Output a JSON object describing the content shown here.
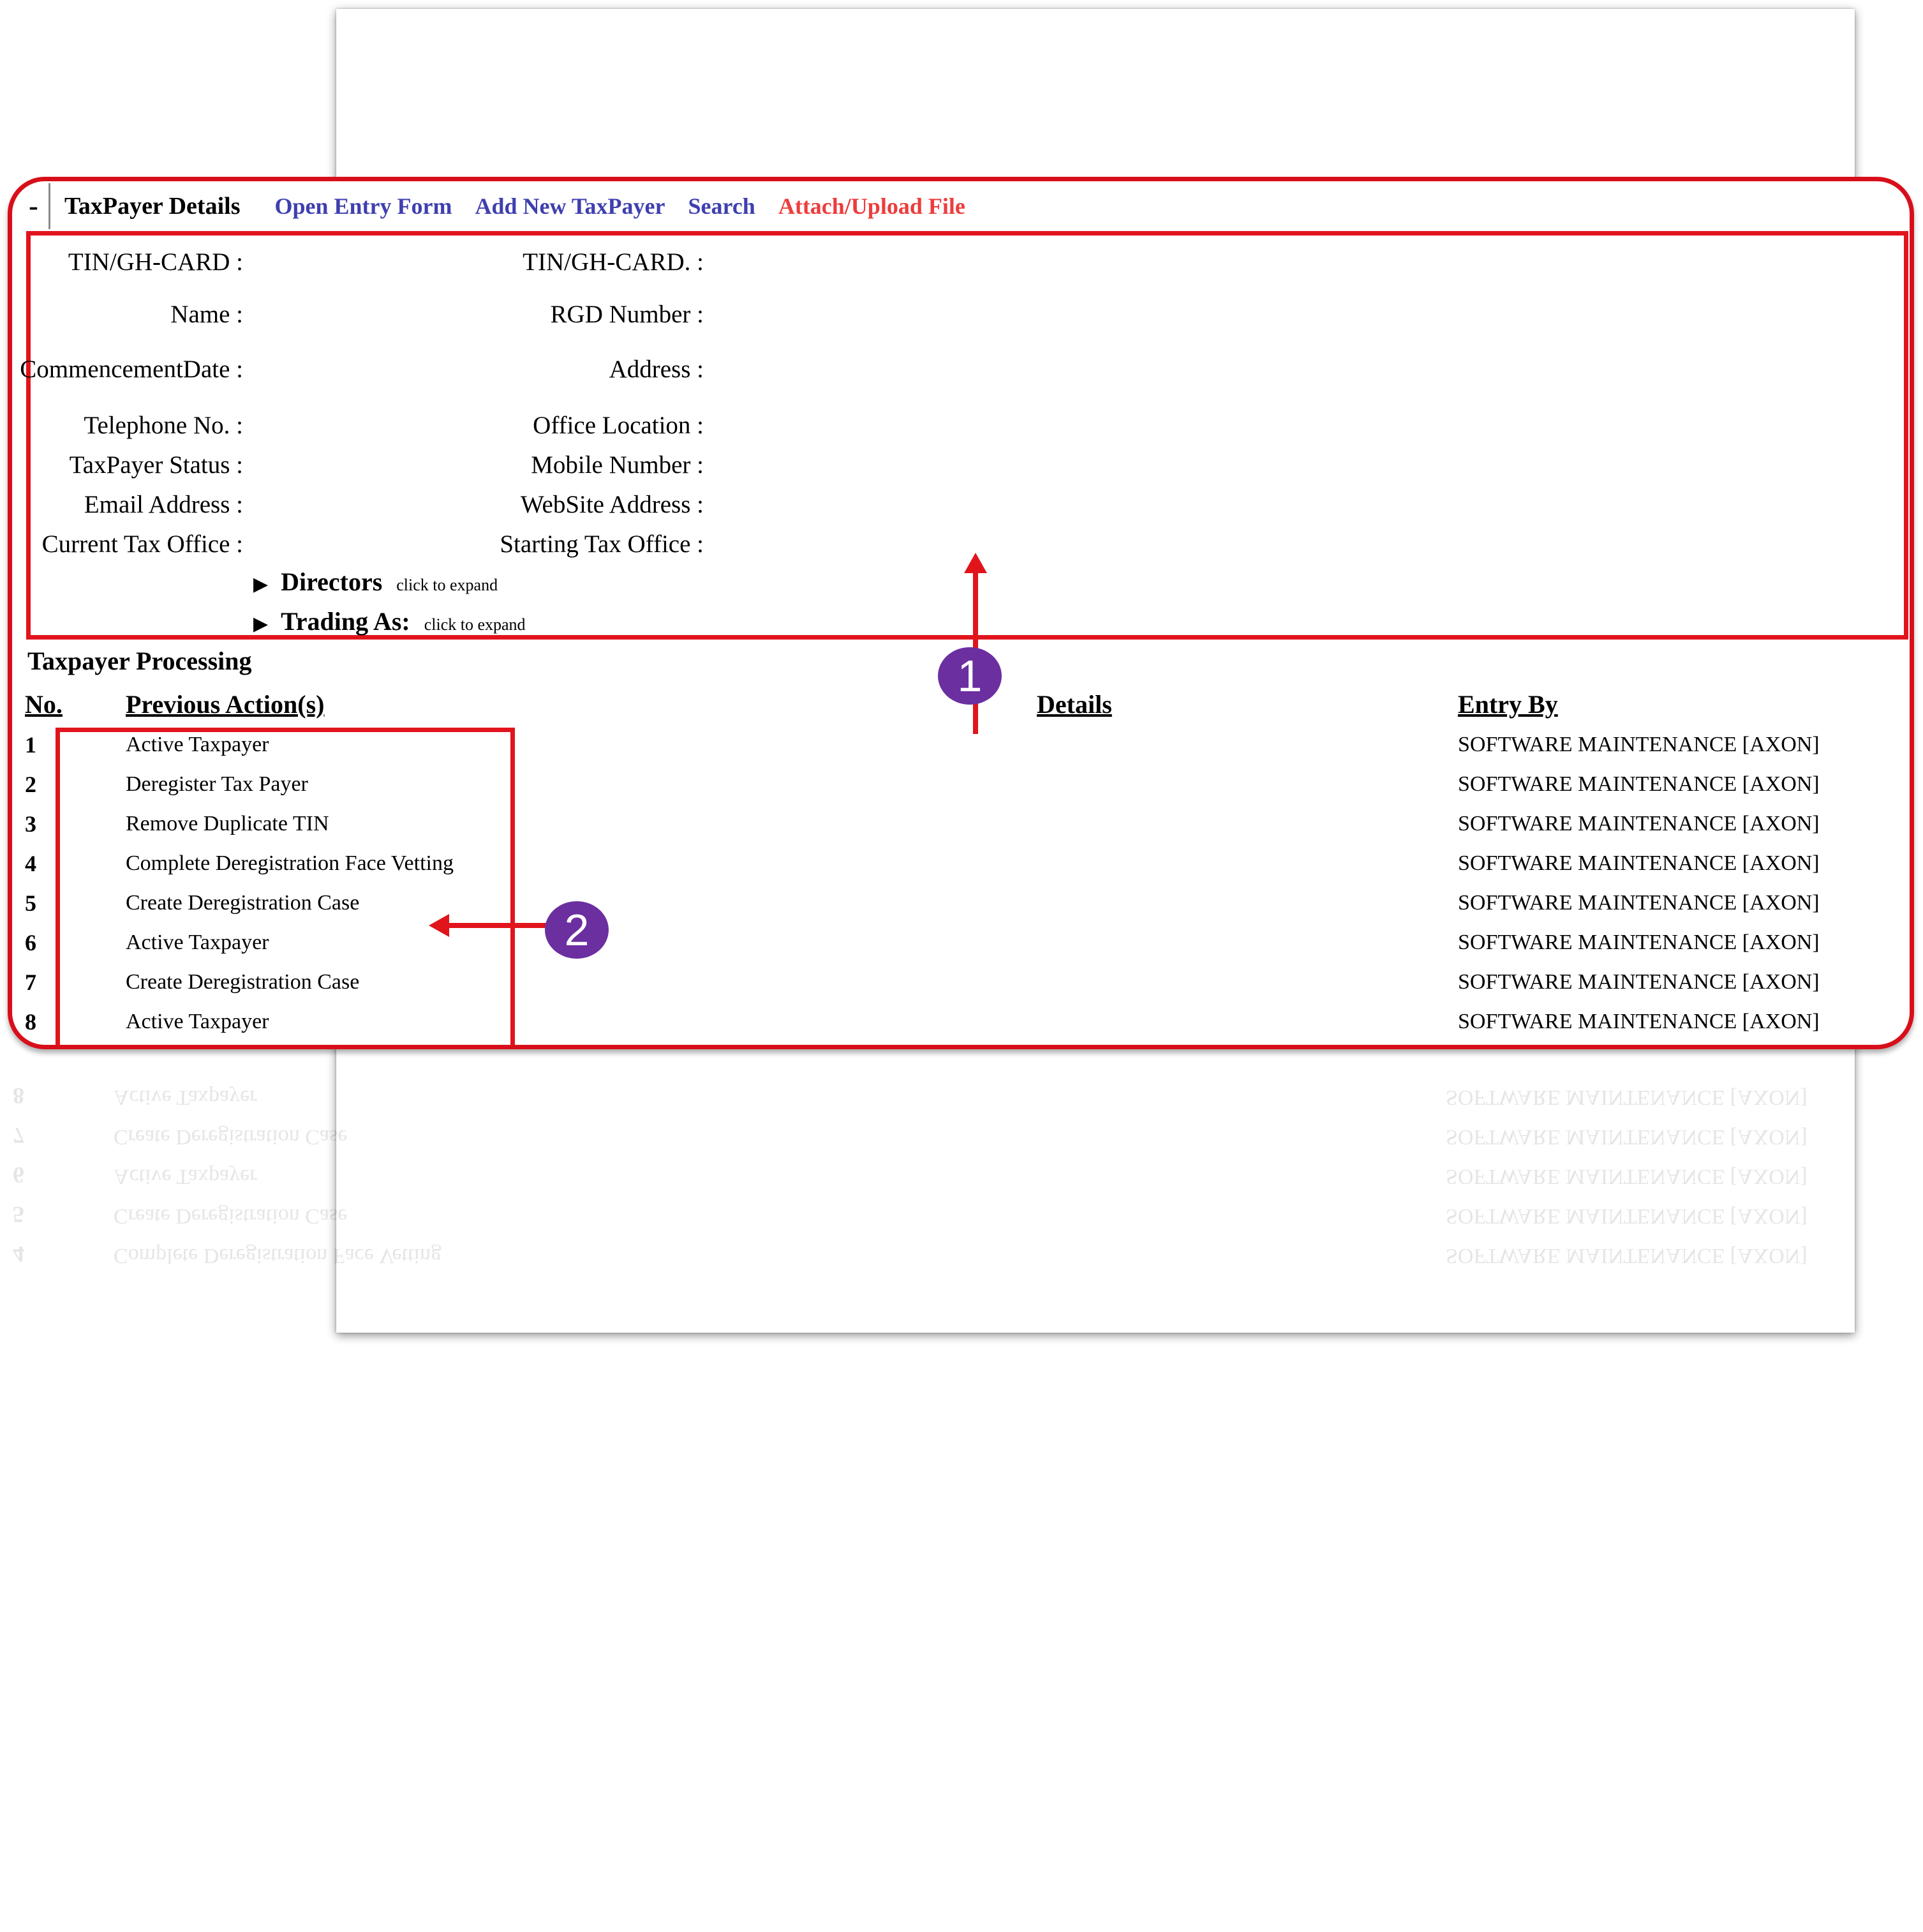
{
  "toolbar": {
    "collapse": "-",
    "title": "TaxPayer Details",
    "links": [
      "Open Entry Form",
      "Add New TaxPayer",
      "Search",
      "Attach/Upload File"
    ]
  },
  "fields": {
    "left": [
      "TIN/GH-CARD :",
      "Name :",
      "CommencementDate :",
      "Telephone No. :",
      "TaxPayer Status :",
      "Email Address :",
      "Current Tax Office :"
    ],
    "right": [
      "TIN/GH-CARD. :",
      "RGD Number :",
      "Address :",
      "Office Location :",
      "Mobile Number :",
      "WebSite Address :",
      "Starting Tax Office :"
    ]
  },
  "expanders": {
    "directors": {
      "label": "Directors",
      "hint": "click to expand"
    },
    "trading": {
      "label": "Trading As:",
      "hint": "click to expand"
    }
  },
  "processing": {
    "title": "Taxpayer Processing",
    "headers": {
      "no": "No.",
      "action": "Previous Action(s)",
      "details": "Details",
      "entry": "Entry By"
    },
    "rows": [
      {
        "no": "1",
        "action": "Active Taxpayer",
        "entry": "SOFTWARE MAINTENANCE [AXON]"
      },
      {
        "no": "2",
        "action": "Deregister Tax Payer",
        "entry": "SOFTWARE MAINTENANCE [AXON]"
      },
      {
        "no": "3",
        "action": "Remove Duplicate TIN",
        "entry": "SOFTWARE MAINTENANCE [AXON]"
      },
      {
        "no": "4",
        "action": "Complete Deregistration Face Vetting",
        "entry": "SOFTWARE MAINTENANCE [AXON]"
      },
      {
        "no": "5",
        "action": "Create Deregistration Case",
        "entry": "SOFTWARE MAINTENANCE [AXON]"
      },
      {
        "no": "6",
        "action": "Active Taxpayer",
        "entry": "SOFTWARE MAINTENANCE [AXON]"
      },
      {
        "no": "7",
        "action": "Create Deregistration Case",
        "entry": "SOFTWARE MAINTENANCE [AXON]"
      },
      {
        "no": "8",
        "action": "Active Taxpayer",
        "entry": "SOFTWARE MAINTENANCE [AXON]"
      }
    ]
  },
  "callouts": {
    "one": "1",
    "two": "2"
  },
  "colors": {
    "highlight": "#e1141c",
    "link": "#3f3fb0",
    "upload_link": "#ee3c3c",
    "badge": "#6b2fa0"
  },
  "icons": {
    "expand": "triangle-right-icon",
    "collapse": "minus-icon"
  }
}
